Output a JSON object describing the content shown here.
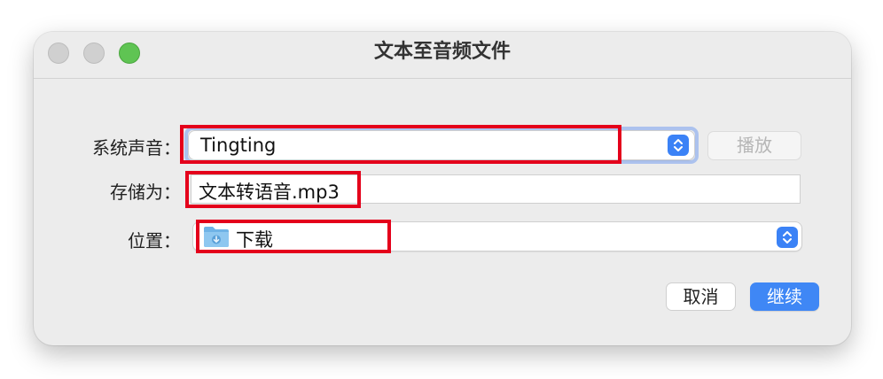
{
  "window": {
    "title": "文本至音频文件"
  },
  "form": {
    "voice_label": "系统声音：",
    "voice_value": "Tingting",
    "save_as_label": "存储为：",
    "save_as_value": "文本转语音.mp3",
    "location_label": "位置：",
    "location_value": "下载"
  },
  "buttons": {
    "play": "播放",
    "cancel": "取消",
    "continue": "继续"
  },
  "icons": {
    "location_icon": "downloads-folder-icon",
    "popup_arrows": "up-down-chevron-icon"
  },
  "colors": {
    "accent": "#3f87f5",
    "highlight": "#e4001b"
  }
}
